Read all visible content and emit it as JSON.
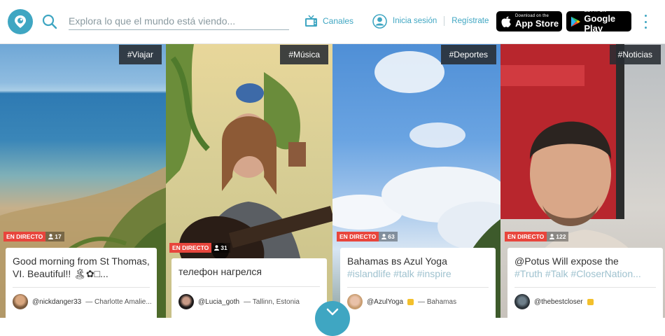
{
  "header": {
    "search": {
      "placeholder": "Explora lo que el mundo está viendo..."
    },
    "channels_label": "Canales",
    "login_label": "Inicia sesión",
    "register_label": "Regístrate",
    "appstore": {
      "small": "Download on the",
      "big": "App Store"
    },
    "googleplay": {
      "small": "GET IT ON",
      "big": "Google Play"
    }
  },
  "broadcasts": [
    {
      "tag": "#Viajar",
      "live": "EN DIRECTO",
      "viewers": "17",
      "title": "Good morning from St Thomas, VI. Beautiful!! 🏝✿□...",
      "title_tags": "",
      "handle": "@nickdanger33",
      "location": "— Charlotte Amalie..."
    },
    {
      "tag": "#Música",
      "live": "EN DIRECTO",
      "viewers": "31",
      "title": "телефон нагрелся",
      "title_tags": "",
      "handle": "@Lucia_goth",
      "location": "— Tallinn, Estonia"
    },
    {
      "tag": "#Deportes",
      "live": "EN DIRECTO",
      "viewers": "63",
      "title": "Bahamas вs Azul Yoga",
      "title_tags": "#islandlife #talk #inspire",
      "handle": "@AzulYoga",
      "location": "— Bahamas"
    },
    {
      "tag": "#Noticias",
      "live": "EN DIRECTO",
      "viewers": "122",
      "title": "@Potus Will expose the",
      "title_tags": "#Truth #Talk #CloserNation...",
      "handle": "@thebestcloser",
      "location": ""
    }
  ],
  "colors": {
    "accent": "#3fa6c2",
    "live": "#e8453c",
    "tag_bg": "#2a2e33"
  }
}
